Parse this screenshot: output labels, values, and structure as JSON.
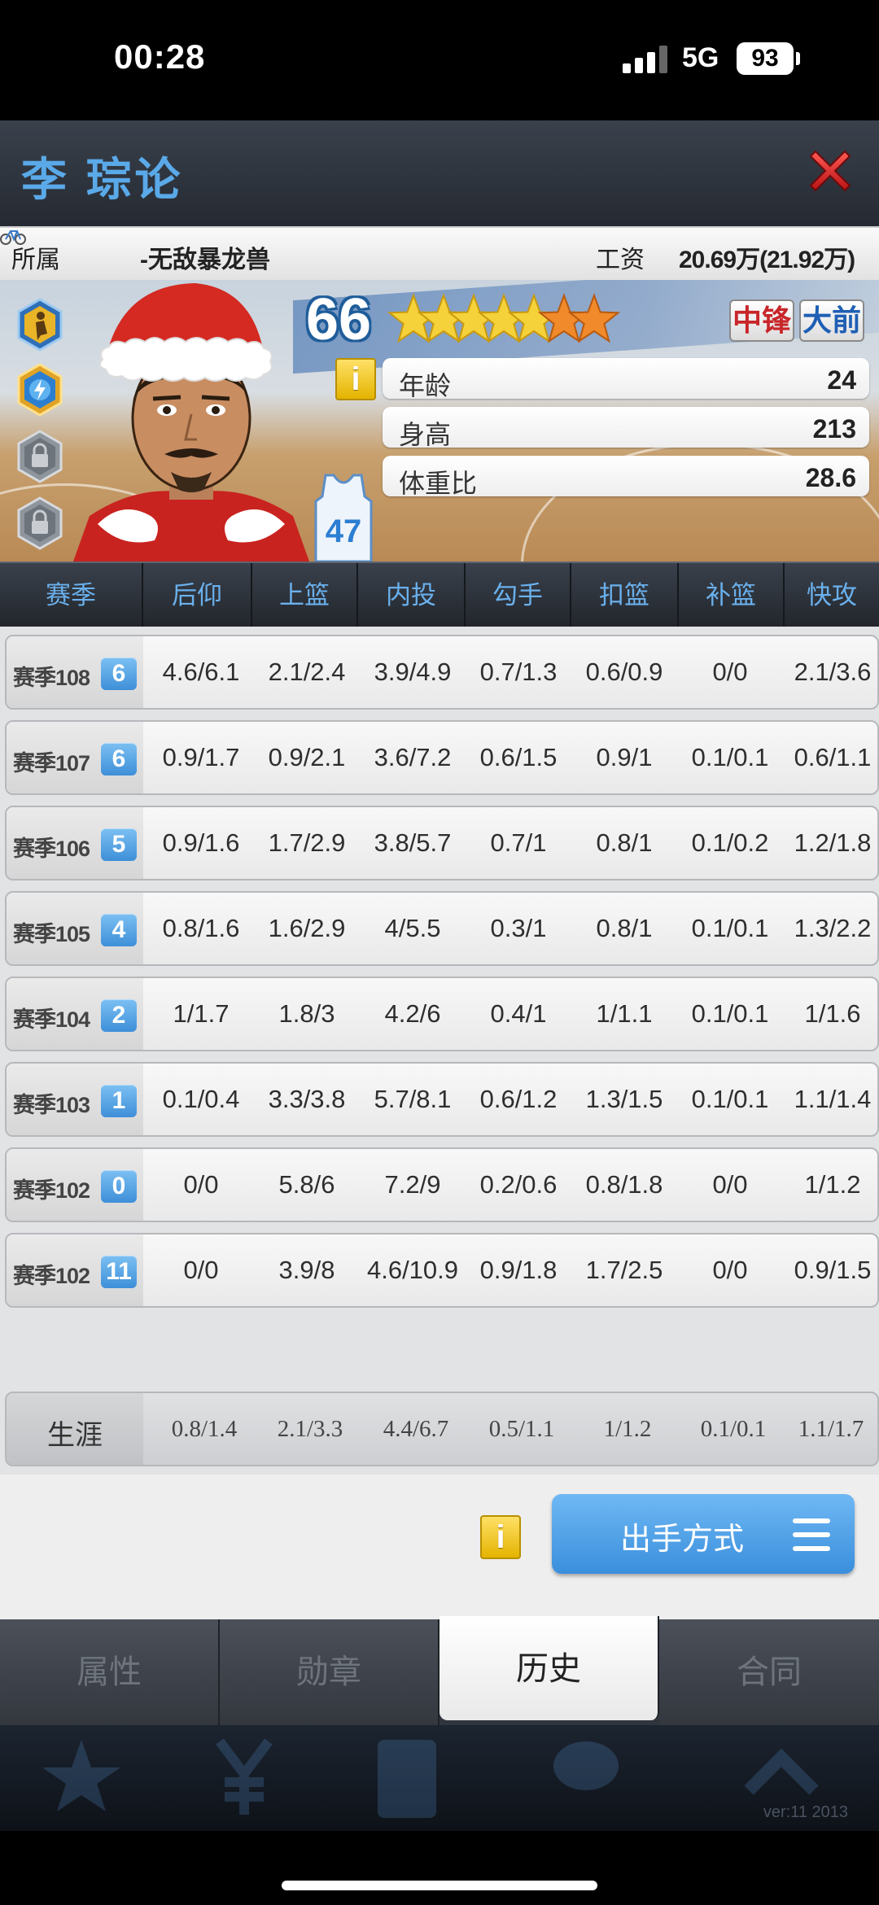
{
  "status_bar": {
    "time": "00:28",
    "network": "5G",
    "battery": "93"
  },
  "header": {
    "player_name": "李 琮论"
  },
  "info": {
    "team_label": "所属",
    "team": "-无敌暴龙兽",
    "salary_label": "工资",
    "salary": "20.69万(21.92万)"
  },
  "card": {
    "overall": "66",
    "stars_full": 5,
    "stars_half_orange": 2,
    "positions": [
      "中锋",
      "大前"
    ],
    "info_icon": "i",
    "attributes": [
      {
        "label": "年龄",
        "value": "24"
      },
      {
        "label": "身高",
        "value": "213"
      },
      {
        "label": "体重比",
        "value": "28.6"
      }
    ],
    "jersey_number": "47",
    "badges": [
      "basketball-player-badge-icon",
      "lightning-badge-icon",
      "lock-icon",
      "lock-icon"
    ]
  },
  "table": {
    "headers": [
      "赛季",
      "后仰",
      "上篮",
      "内投",
      "勾手",
      "扣篮",
      "补篮",
      "快攻"
    ],
    "rows": [
      {
        "season": "赛季108",
        "num": "6",
        "cells": [
          "4.6/6.1",
          "2.1/2.4",
          "3.9/4.9",
          "0.7/1.3",
          "0.6/0.9",
          "0/0",
          "2.1/3.6"
        ]
      },
      {
        "season": "赛季107",
        "num": "6",
        "cells": [
          "0.9/1.7",
          "0.9/2.1",
          "3.6/7.2",
          "0.6/1.5",
          "0.9/1",
          "0.1/0.1",
          "0.6/1.1"
        ]
      },
      {
        "season": "赛季106",
        "num": "5",
        "cells": [
          "0.9/1.6",
          "1.7/2.9",
          "3.8/5.7",
          "0.7/1",
          "0.8/1",
          "0.1/0.2",
          "1.2/1.8"
        ]
      },
      {
        "season": "赛季105",
        "num": "4",
        "cells": [
          "0.8/1.6",
          "1.6/2.9",
          "4/5.5",
          "0.3/1",
          "0.8/1",
          "0.1/0.1",
          "1.3/2.2"
        ]
      },
      {
        "season": "赛季104",
        "num": "2",
        "cells": [
          "1/1.7",
          "1.8/3",
          "4.2/6",
          "0.4/1",
          "1/1.1",
          "0.1/0.1",
          "1/1.6"
        ]
      },
      {
        "season": "赛季103",
        "num": "1",
        "cells": [
          "0.1/0.4",
          "3.3/3.8",
          "5.7/8.1",
          "0.6/1.2",
          "1.3/1.5",
          "0.1/0.1",
          "1.1/1.4"
        ]
      },
      {
        "season": "赛季102",
        "num": "0",
        "cells": [
          "0/0",
          "5.8/6",
          "7.2/9",
          "0.2/0.6",
          "0.8/1.8",
          "0/0",
          "1/1.2"
        ]
      },
      {
        "season": "赛季102",
        "num": "11",
        "cells": [
          "0/0",
          "3.9/8",
          "4.6/10.9",
          "0.9/1.8",
          "1.7/2.5",
          "0/0",
          "0.9/1.5"
        ]
      }
    ],
    "career": {
      "label": "生涯",
      "cells": [
        "0.8/1.4",
        "2.1/3.3",
        "4.4/6.7",
        "0.5/1.1",
        "1/1.2",
        "0.1/0.1",
        "1.1/1.7"
      ]
    }
  },
  "actions": {
    "info_icon": "i",
    "shoot_label": "出手方式"
  },
  "tabs": [
    {
      "label": "属性",
      "active": false
    },
    {
      "label": "勋章",
      "active": false
    },
    {
      "label": "历史",
      "active": true
    },
    {
      "label": "合同",
      "active": false
    }
  ],
  "footer": {
    "version": "ver:11  2013"
  },
  "colors": {
    "accent_blue": "#5aa9e8",
    "close_red": "#d8262a",
    "button_blue": "#4a9ae4"
  }
}
